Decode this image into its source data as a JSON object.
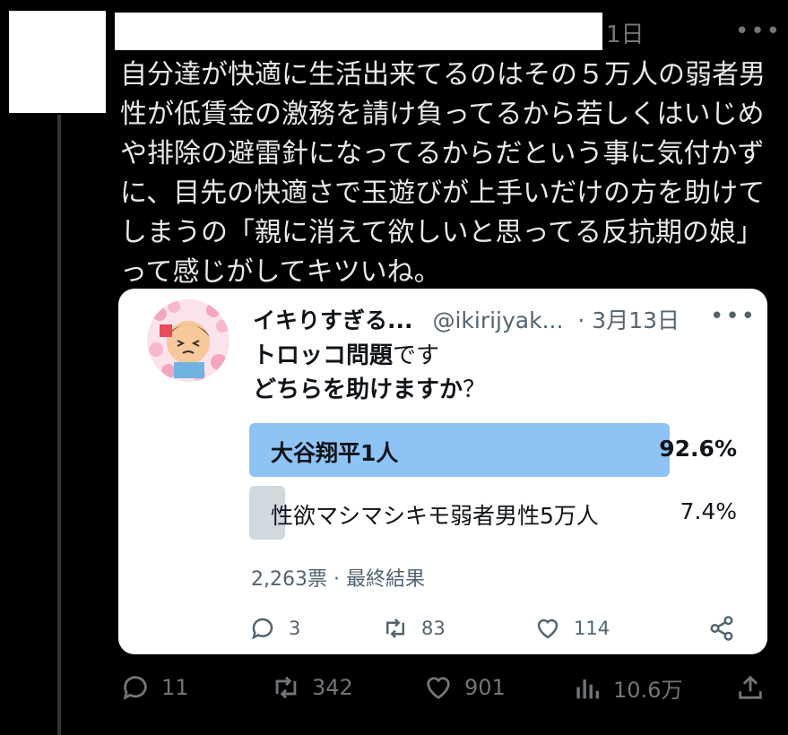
{
  "tweet": {
    "time": "1日",
    "text": "自分達が快適に生活出来てるのはその５万人の弱者男性が低賃金の激務を請け負ってるから若しくはいじめや排除の避雷針になってるからだという事に気付かずに、目先の快適さで玉遊びが上手いだけの方を助けてしまうの「親に消えて欲しいと思ってる反抗期の娘」って感じがしてキツいね。",
    "actions": {
      "replies": "11",
      "retweets": "342",
      "likes": "901",
      "views": "10.6万"
    }
  },
  "quote": {
    "name": "イキりすぎる...",
    "handle": "@ikirijyak...",
    "date": "· 3月13日",
    "line1_bold": "トロッコ問題",
    "line1_rest": "です",
    "line2_bold": "どちらを助けますか",
    "line2_rest": "？",
    "poll": {
      "options": [
        {
          "label": "大谷翔平1人",
          "percent": "92.6%",
          "fraction": 0.926,
          "winner": true
        },
        {
          "label": "性欲マシマシキモ弱者男性5万人",
          "percent": "7.4%",
          "fraction": 0.074,
          "winner": false
        }
      ],
      "votes": "2,263票",
      "status": "最終結果",
      "separator": "·"
    },
    "actions": {
      "replies": "3",
      "retweets": "83",
      "likes": "114"
    }
  },
  "colors": {
    "background": "#000000",
    "poll_winner": "#8ec3f5",
    "poll_loser": "#cfd9de"
  }
}
